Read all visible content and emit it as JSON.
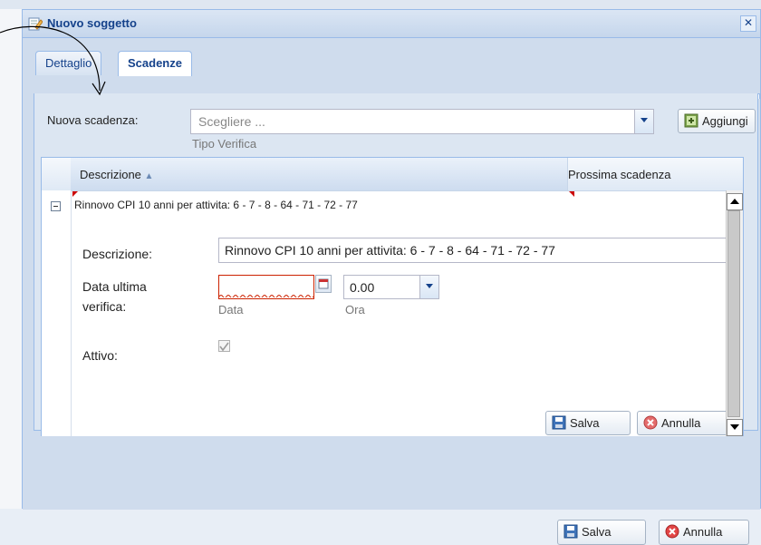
{
  "dialog": {
    "title": "Nuovo soggetto",
    "close_icon": "close-icon",
    "title_icon": "edit-document-icon"
  },
  "tabs": [
    {
      "label": "Dettaglio",
      "active": false
    },
    {
      "label": "Scadenze",
      "active": true
    }
  ],
  "new_deadline": {
    "label": "Nuova scadenza:",
    "placeholder": "Scegliere ...",
    "hint": "Tipo Verifica",
    "add_button": "Aggiungi"
  },
  "grid": {
    "columns": [
      "Descrizione",
      "Prossima scadenza"
    ],
    "sort": "ascending",
    "rows": [
      {
        "descrizione": "Rinnovo CPI 10 anni per attivita: 6 - 7 - 8 - 64 - 71 - 72 - 77",
        "prossima_scadenza": ""
      }
    ]
  },
  "detail": {
    "descrizione_label": "Descrizione:",
    "descrizione_value": "Rinnovo CPI 10 anni per attivita: 6 - 7 - 8 - 64 - 71 - 72 - 77",
    "data_label_line1": "Data ultima",
    "data_label_line2": "verifica:",
    "data_value": "",
    "data_hint": "Data",
    "ora_value": "0.00",
    "ora_hint": "Ora",
    "attivo_label": "Attivo:",
    "attivo_checked": true,
    "save_button": "Salva",
    "cancel_button": "Annulla"
  },
  "footer": {
    "save_button": "Salva",
    "cancel_button": "Annulla"
  },
  "colors": {
    "header_blue": "#15428b",
    "border_blue": "#99bbe8",
    "panel_bg": "#dce6f2",
    "error_red": "#cc2200"
  }
}
